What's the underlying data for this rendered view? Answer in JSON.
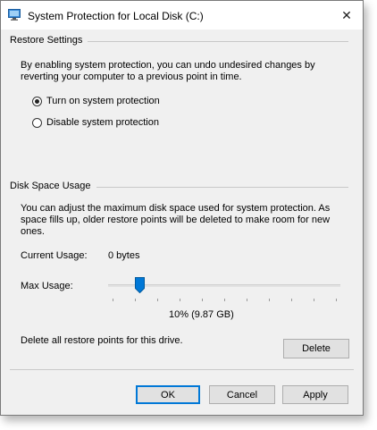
{
  "window": {
    "title": "System Protection for Local Disk (C:)",
    "close_glyph": "✕"
  },
  "restore_settings": {
    "group_label": "Restore Settings",
    "description": "By enabling system protection, you can undo undesired changes by reverting your computer to a previous point in time.",
    "options": [
      {
        "label": "Turn on system protection",
        "selected": true
      },
      {
        "label": "Disable system protection",
        "selected": false
      }
    ]
  },
  "disk_space": {
    "group_label": "Disk Space Usage",
    "description": "You can adjust the maximum disk space used for system protection. As space fills up, older restore points will be deleted to make room for new ones.",
    "current_usage_label": "Current Usage:",
    "current_usage_value": "0 bytes",
    "max_usage_label": "Max Usage:",
    "max_usage_fraction": 0.1,
    "max_usage_readout": "10% (9.87 GB)",
    "delete_text": "Delete all restore points for this drive.",
    "delete_button": "Delete"
  },
  "footer": {
    "ok": "OK",
    "cancel": "Cancel",
    "apply": "Apply"
  },
  "colors": {
    "accent": "#0078d7",
    "dialog_bg": "#f0f0f0",
    "button_bg": "#e1e1e1"
  },
  "icons": {
    "title_icon": "system-protection-icon",
    "close_icon": "close-icon"
  }
}
